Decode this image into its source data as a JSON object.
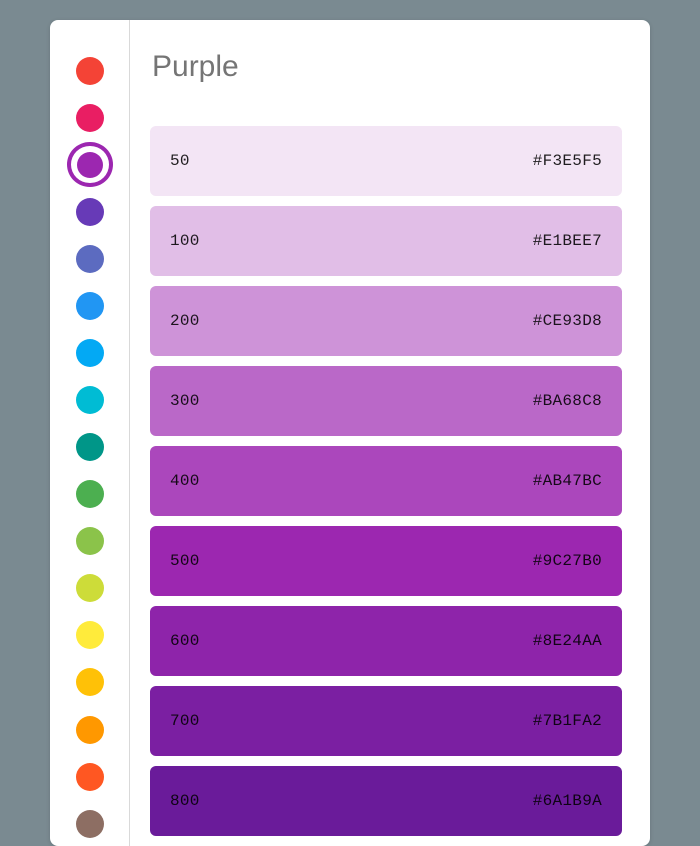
{
  "palette_title": "Purple",
  "sidebar_colors": [
    {
      "name": "red",
      "hex": "#f44336",
      "selected": false
    },
    {
      "name": "pink",
      "hex": "#e91e63",
      "selected": false
    },
    {
      "name": "purple",
      "hex": "#9c27b0",
      "selected": true
    },
    {
      "name": "deep-purple",
      "hex": "#673ab7",
      "selected": false
    },
    {
      "name": "indigo",
      "hex": "#5C6BC0",
      "selected": false
    },
    {
      "name": "blue",
      "hex": "#2196f3",
      "selected": false
    },
    {
      "name": "light-blue",
      "hex": "#03a9f4",
      "selected": false
    },
    {
      "name": "cyan",
      "hex": "#00bcd4",
      "selected": false
    },
    {
      "name": "teal",
      "hex": "#009688",
      "selected": false
    },
    {
      "name": "green",
      "hex": "#4caf50",
      "selected": false
    },
    {
      "name": "light-green",
      "hex": "#8bc34a",
      "selected": false
    },
    {
      "name": "lime",
      "hex": "#cddc39",
      "selected": false
    },
    {
      "name": "yellow",
      "hex": "#ffeb3b",
      "selected": false
    },
    {
      "name": "amber",
      "hex": "#ffc107",
      "selected": false
    },
    {
      "name": "orange",
      "hex": "#ff9800",
      "selected": false
    },
    {
      "name": "deep-orange",
      "hex": "#ff5722",
      "selected": false
    },
    {
      "name": "brown",
      "hex": "#8d6e63",
      "selected": false
    }
  ],
  "shades": [
    {
      "label": "50",
      "hex": "#F3E5F5"
    },
    {
      "label": "100",
      "hex": "#E1BEE7"
    },
    {
      "label": "200",
      "hex": "#CE93D8"
    },
    {
      "label": "300",
      "hex": "#BA68C8"
    },
    {
      "label": "400",
      "hex": "#AB47BC"
    },
    {
      "label": "500",
      "hex": "#9C27B0"
    },
    {
      "label": "600",
      "hex": "#8E24AA"
    },
    {
      "label": "700",
      "hex": "#7B1FA2"
    },
    {
      "label": "800",
      "hex": "#6A1B9A"
    }
  ]
}
